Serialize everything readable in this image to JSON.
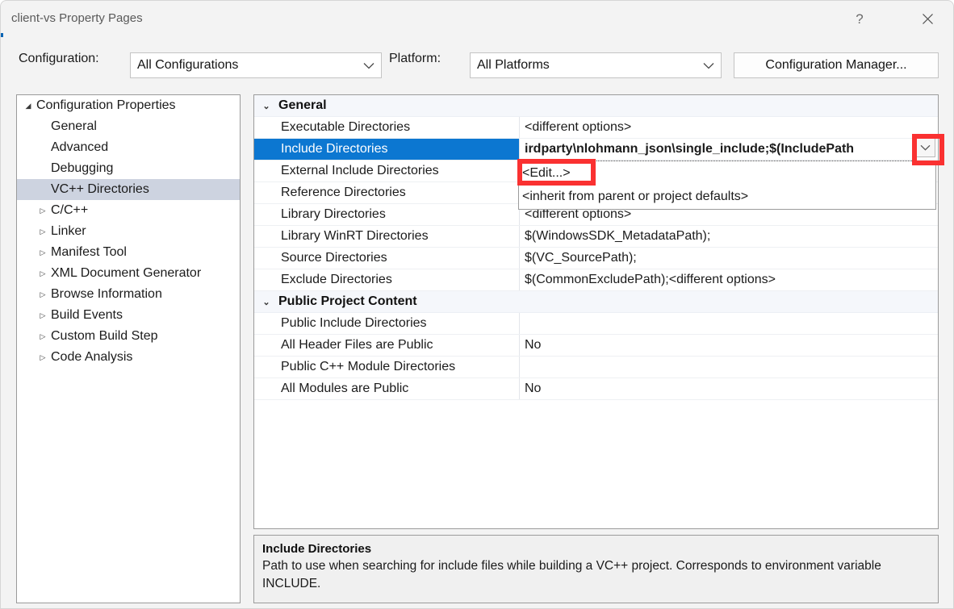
{
  "window": {
    "title": "client-vs Property Pages",
    "help_glyph": "?",
    "close_glyph": "✕"
  },
  "toolbar": {
    "configuration_label": "Configuration:",
    "configuration_value": "All Configurations",
    "platform_label": "Platform:",
    "platform_value": "All Platforms",
    "configuration_manager_label": "Configuration Manager...",
    "chevron": "∨"
  },
  "tree": {
    "items": [
      {
        "label": "Configuration Properties",
        "level": 0,
        "glyph": "◢",
        "selected": false
      },
      {
        "label": "General",
        "level": 1,
        "glyph": "",
        "selected": false
      },
      {
        "label": "Advanced",
        "level": 1,
        "glyph": "",
        "selected": false
      },
      {
        "label": "Debugging",
        "level": 1,
        "glyph": "",
        "selected": false
      },
      {
        "label": "VC++ Directories",
        "level": 1,
        "glyph": "",
        "selected": true
      },
      {
        "label": "C/C++",
        "level": 1,
        "glyph": "▷",
        "selected": false
      },
      {
        "label": "Linker",
        "level": 1,
        "glyph": "▷",
        "selected": false
      },
      {
        "label": "Manifest Tool",
        "level": 1,
        "glyph": "▷",
        "selected": false
      },
      {
        "label": "XML Document Generator",
        "level": 1,
        "glyph": "▷",
        "selected": false
      },
      {
        "label": "Browse Information",
        "level": 1,
        "glyph": "▷",
        "selected": false
      },
      {
        "label": "Build Events",
        "level": 1,
        "glyph": "▷",
        "selected": false
      },
      {
        "label": "Custom Build Step",
        "level": 1,
        "glyph": "▷",
        "selected": false
      },
      {
        "label": "Code Analysis",
        "level": 1,
        "glyph": "▷",
        "selected": false
      }
    ]
  },
  "grid": {
    "expander_open": "⌄",
    "rows": [
      {
        "kind": "group",
        "name": "General"
      },
      {
        "kind": "prop",
        "name": "Executable Directories",
        "value": "<different options>",
        "selected": false
      },
      {
        "kind": "prop",
        "name": "Include Directories",
        "value": "irdparty\\nlohmann_json\\single_include;$(IncludePath",
        "selected": true
      },
      {
        "kind": "prop",
        "name": "External Include Directories",
        "value": "",
        "selected": false
      },
      {
        "kind": "prop",
        "name": "Reference Directories",
        "value": "",
        "selected": false
      },
      {
        "kind": "prop",
        "name": "Library Directories",
        "value": "<different options>",
        "selected": false
      },
      {
        "kind": "prop",
        "name": "Library WinRT Directories",
        "value": "$(WindowsSDK_MetadataPath);",
        "selected": false
      },
      {
        "kind": "prop",
        "name": "Source Directories",
        "value": "$(VC_SourcePath);",
        "selected": false
      },
      {
        "kind": "prop",
        "name": "Exclude Directories",
        "value": "$(CommonExcludePath);<different options>",
        "selected": false
      },
      {
        "kind": "group",
        "name": "Public Project Content"
      },
      {
        "kind": "prop",
        "name": "Public Include Directories",
        "value": "",
        "selected": false
      },
      {
        "kind": "prop",
        "name": "All Header Files are Public",
        "value": "No",
        "selected": false
      },
      {
        "kind": "prop",
        "name": "Public C++ Module Directories",
        "value": "",
        "selected": false
      },
      {
        "kind": "prop",
        "name": "All Modules are Public",
        "value": "No",
        "selected": false
      }
    ]
  },
  "dropdown": {
    "open": true,
    "toggle_glyph": "∨",
    "items": [
      {
        "label": "<Edit...>"
      },
      {
        "label": "<inherit from parent or project defaults>"
      }
    ]
  },
  "description": {
    "title": "Include Directories",
    "body": "Path to use when searching for include files while building a VC++ project.  Corresponds to environment variable INCLUDE."
  },
  "colors": {
    "selection_blue": "#0c77d1",
    "tree_selection": "#cdd3e0",
    "annotation_red": "#fa3131",
    "dialog_bg": "#f3f3f3"
  }
}
